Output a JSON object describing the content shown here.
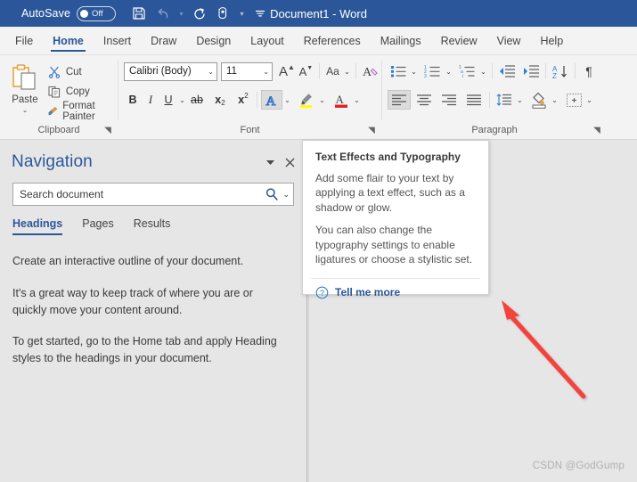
{
  "titlebar": {
    "autosave_label": "AutoSave",
    "autosave_state": "Off",
    "document_title": "Document1  -  Word",
    "quick_access": [
      {
        "name": "save-icon",
        "label": "Save"
      },
      {
        "name": "undo-icon",
        "label": "Undo"
      },
      {
        "name": "redo-icon",
        "label": "Redo"
      },
      {
        "name": "touch-mode-icon",
        "label": "Touch/Mouse Mode"
      },
      {
        "name": "customize-qat-icon",
        "label": "Customize Quick Access Toolbar"
      }
    ],
    "bg_color": "#2b579a"
  },
  "ribbon": {
    "tabs": [
      {
        "label": "File",
        "active": false
      },
      {
        "label": "Home",
        "active": true
      },
      {
        "label": "Insert",
        "active": false
      },
      {
        "label": "Draw",
        "active": false
      },
      {
        "label": "Design",
        "active": false
      },
      {
        "label": "Layout",
        "active": false
      },
      {
        "label": "References",
        "active": false
      },
      {
        "label": "Mailings",
        "active": false
      },
      {
        "label": "Review",
        "active": false
      },
      {
        "label": "View",
        "active": false
      },
      {
        "label": "Help",
        "active": false
      }
    ],
    "accent_color": "#2b579a",
    "groups": {
      "clipboard": {
        "label": "Clipboard",
        "paste_label": "Paste",
        "items": [
          {
            "label": "Cut",
            "icon": "scissors-icon"
          },
          {
            "label": "Copy",
            "icon": "copy-icon"
          },
          {
            "label": "Format Painter",
            "icon": "paintbrush-icon"
          }
        ]
      },
      "font": {
        "label": "Font",
        "font_name": "Calibri (Body)",
        "font_size": "11",
        "buttons": [
          {
            "name": "grow-font",
            "glyph": "A"
          },
          {
            "name": "shrink-font",
            "glyph": "A"
          },
          {
            "name": "change-case",
            "glyph": "Aa"
          },
          {
            "name": "clear-formatting",
            "glyph": "A"
          },
          {
            "name": "bold",
            "glyph": "B"
          },
          {
            "name": "italic",
            "glyph": "I"
          },
          {
            "name": "underline",
            "glyph": "U"
          },
          {
            "name": "strikethrough",
            "glyph": "ab"
          },
          {
            "name": "subscript",
            "glyph": "x"
          },
          {
            "name": "superscript",
            "glyph": "x"
          },
          {
            "name": "text-effects",
            "glyph": "A",
            "selected": true
          },
          {
            "name": "text-highlight-color",
            "glyph": "pen",
            "color": "#ffff00"
          },
          {
            "name": "font-color",
            "glyph": "A",
            "color": "#e02020"
          }
        ]
      },
      "paragraph": {
        "label": "Paragraph",
        "buttons": [
          {
            "name": "bullets"
          },
          {
            "name": "numbering"
          },
          {
            "name": "multilevel-list"
          },
          {
            "name": "decrease-indent"
          },
          {
            "name": "increase-indent"
          },
          {
            "name": "sort"
          },
          {
            "name": "show-formatting-marks"
          },
          {
            "name": "align-left",
            "selected": true
          },
          {
            "name": "align-center"
          },
          {
            "name": "align-right"
          },
          {
            "name": "justify"
          },
          {
            "name": "line-spacing"
          },
          {
            "name": "shading",
            "color": "#ffffff"
          },
          {
            "name": "borders"
          }
        ]
      }
    }
  },
  "navigation": {
    "title": "Navigation",
    "search_placeholder": "Search document",
    "search_value": "",
    "tabs": [
      {
        "label": "Headings",
        "active": true
      },
      {
        "label": "Pages",
        "active": false
      },
      {
        "label": "Results",
        "active": false
      }
    ],
    "paragraphs": [
      "Create an interactive outline of your document.",
      "It's a great way to keep track of where you are or quickly move your content around.",
      "To get started, go to the Home tab and apply Heading styles to the headings in your document."
    ]
  },
  "tooltip": {
    "title": "Text Effects and Typography",
    "paragraphs": [
      "Add some flair to your text by applying a text effect, such as a shadow or glow.",
      "You can also change the typography settings to enable ligatures or choose a stylistic set."
    ],
    "link_label": "Tell me more",
    "link_icon": "help-circle-icon",
    "link_color": "#2b579a"
  },
  "annotation": {
    "arrow_color": "#f4433c",
    "arrow_from": "655,445",
    "arrow_to": "560,335"
  },
  "watermark": {
    "text": "CSDN @GodGump"
  }
}
